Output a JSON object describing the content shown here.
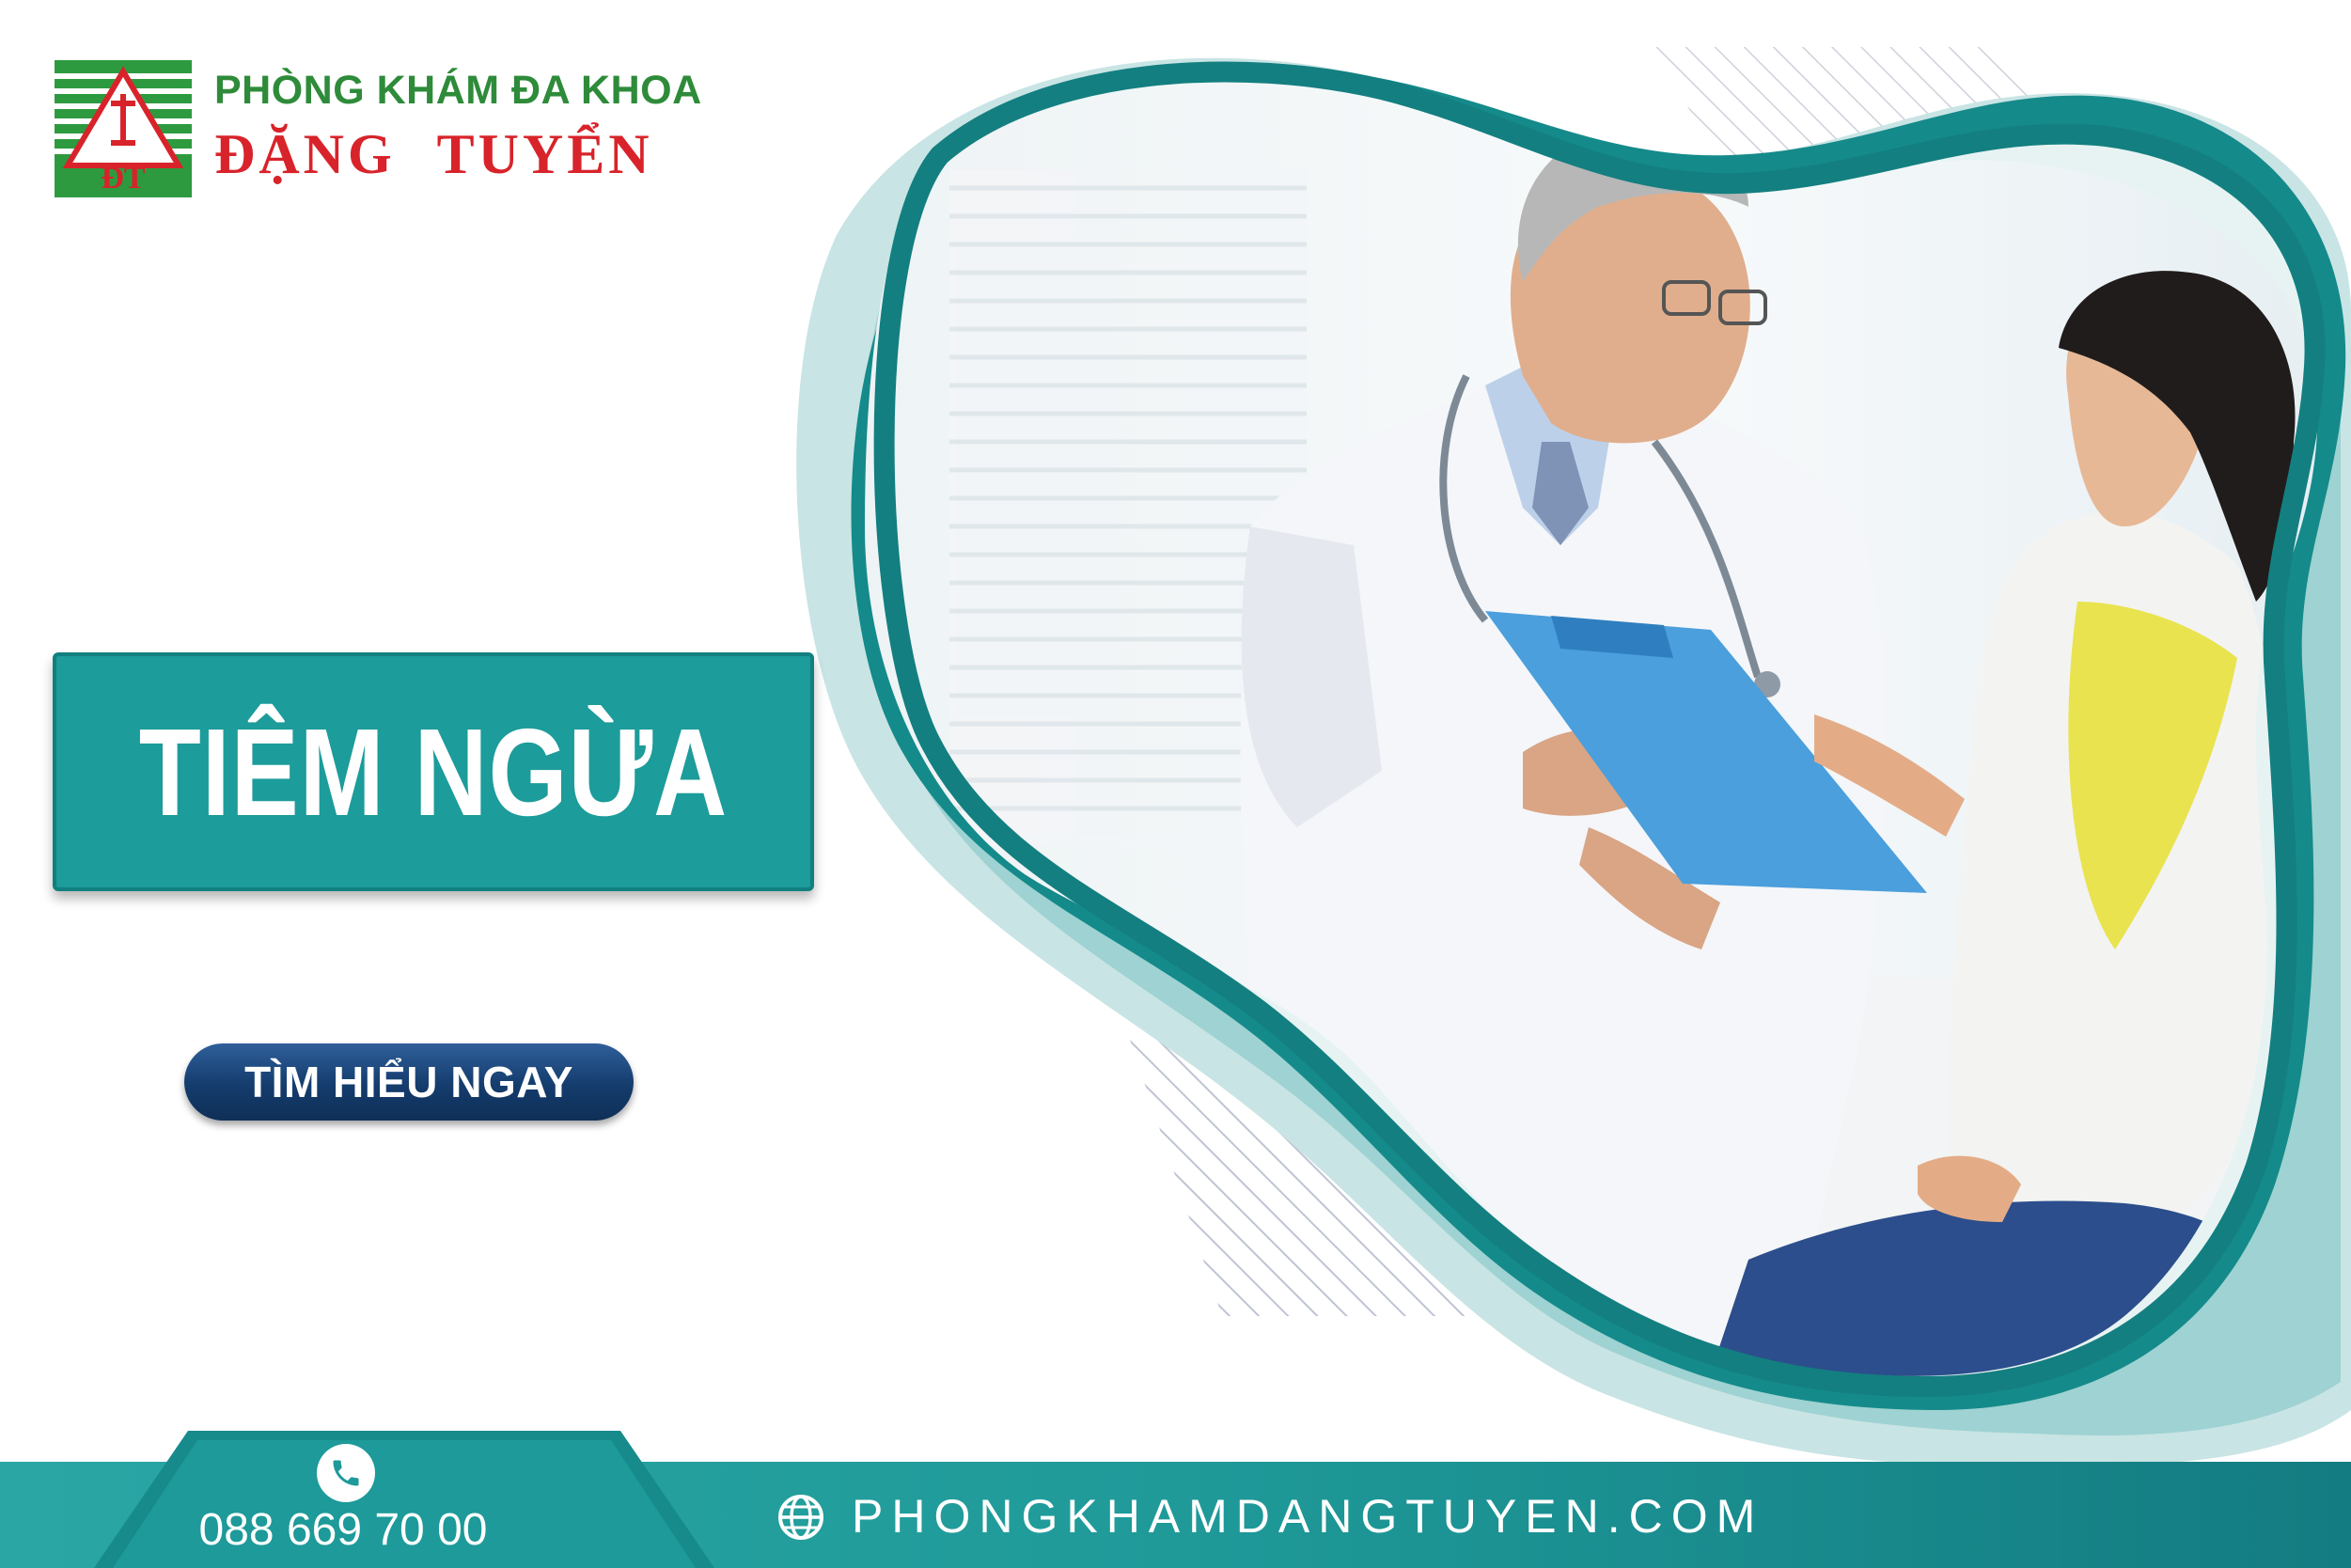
{
  "brand": {
    "line1": "PHÒNG KHÁM ĐA KHOA",
    "line2": "ĐẶNG  TUYỂN",
    "logo_letters": "ĐT",
    "colors": {
      "green": "#2e8b3a",
      "red": "#d8232a"
    }
  },
  "banner": {
    "title": "TIÊM NGỪA",
    "color": "#1c9c9a"
  },
  "cta": {
    "label": "TÌM HIỂU NGAY",
    "color": "#143c6d"
  },
  "hero": {
    "image_alt": "doctor-and-patient-photo",
    "frame_color": "#158a8a"
  },
  "footer": {
    "phone": "088 669 70 00",
    "website": "PHONGKHAMDANGTUYEN.COM",
    "phone_icon": "phone-icon",
    "globe_icon": "globe-icon",
    "color": "#1f9a99"
  }
}
